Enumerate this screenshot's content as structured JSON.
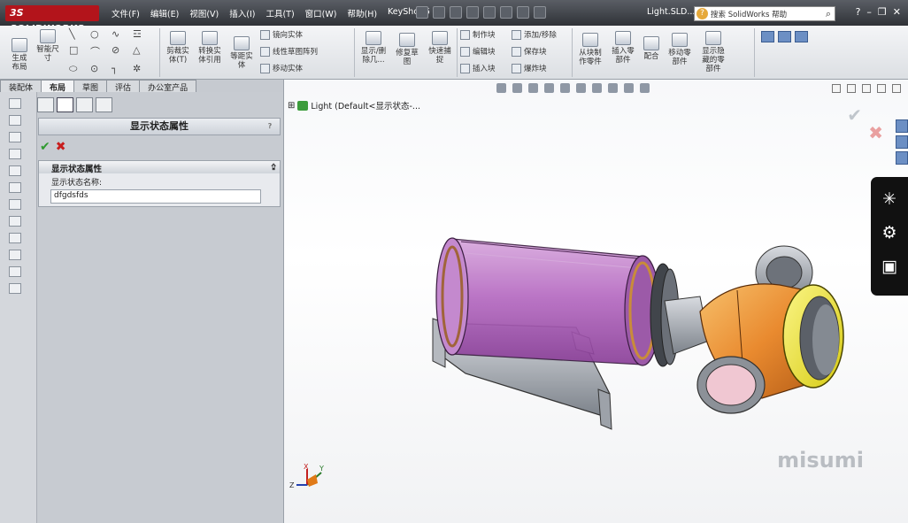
{
  "app": {
    "logo_text": "3S SOLIDWORKS",
    "menu": [
      "文件(F)",
      "编辑(E)",
      "视图(V)",
      "插入(I)",
      "工具(T)",
      "窗口(W)",
      "帮助(H)",
      "KeyShot 5"
    ],
    "document_title": "Light.SLD...",
    "search_placeholder": "搜索 SolidWorks 帮助",
    "search_icon": "magnifier-icon"
  },
  "command_manager": {
    "buttons": {
      "generate_layout": "生成\n布局",
      "smart_dimension": "智能尺\n寸",
      "trim_entities": "剪裁实\n体(T)",
      "convert_entities": "转换实\n体引用",
      "offset_entities": "等距实\n体",
      "mirror_entities": "镜向实体",
      "linear_pattern": "线性草图阵列",
      "move_entities": "移动实体",
      "show_delete_relations": "显示/删\n除几...",
      "repair_sketch": "修复草\n图",
      "rapid_snaps": "快速捕\n捉",
      "make_block": "制作块",
      "edit_block": "编辑块",
      "insert_block": "插入块",
      "add_remove": "添加/移除",
      "save_block": "保存块",
      "explode_block": "爆炸块",
      "make_part_from_block": "从块制\n作零件",
      "insert_component": "插入零\n部件",
      "mate": "配合",
      "move_component": "移动零\n部件",
      "show_hidden_components": "显示隐\n藏的零\n部件"
    }
  },
  "tabs": [
    "装配体",
    "布局",
    "草图",
    "评估",
    "办公室产品"
  ],
  "active_tab": "布局",
  "property_manager": {
    "title": "显示状态属性",
    "help_label": "?",
    "ok_icon": "check-icon",
    "cancel_icon": "close-icon",
    "group_title": "显示状态属性",
    "field_label": "显示状态名称:",
    "field_value": "dfgdsfds"
  },
  "graphics": {
    "tree_label": "Light  (Default<显示状态-...",
    "watermark": "misumi",
    "triad_labels": {
      "x": "X",
      "y": "Y",
      "z": "Z"
    }
  },
  "share_panel": {
    "items": [
      "share-icon",
      "gear-icon",
      "monitor-icon"
    ]
  },
  "colors": {
    "purple_body": "#b66bc2",
    "orange_head": "#e98a2f",
    "yellow_ring": "#f1ea2a",
    "gray_metal": "#9ea3aa",
    "logo_red": "#b3141b"
  }
}
